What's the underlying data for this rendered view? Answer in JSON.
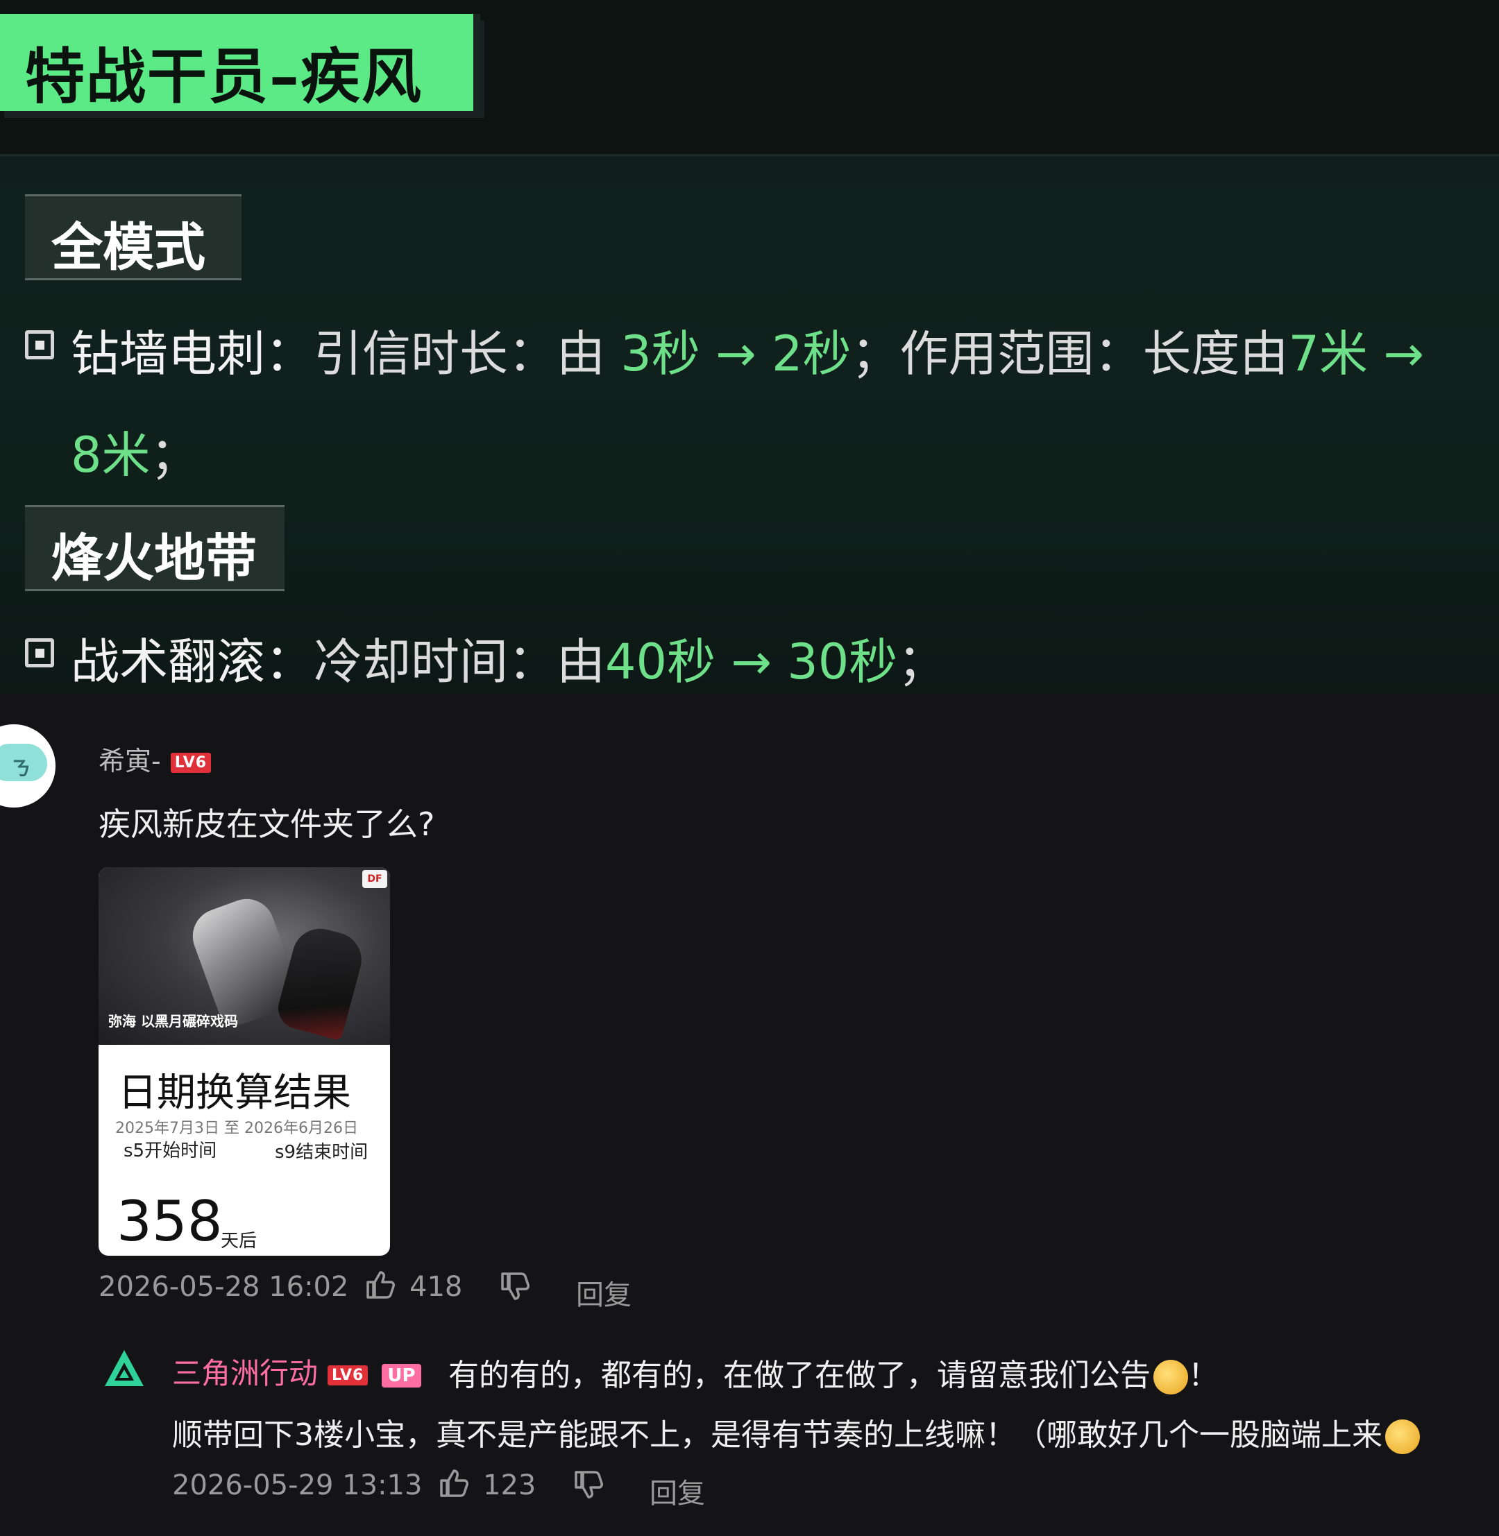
{
  "patch": {
    "title": "特战干员–疾风",
    "sections": [
      {
        "tag": "全模式",
        "items": [
          {
            "name": "钻墙电刺：",
            "line1_a": "引信时长：由 ",
            "line1_b": "3秒",
            "line1_c": " → ",
            "line1_d": "2秒",
            "line1_e": "；作用范围：长度由",
            "line1_f": "7米",
            "line1_g": " →",
            "line2_a": "8米",
            "line2_b": "；"
          }
        ]
      },
      {
        "tag": "烽火地带",
        "items": [
          {
            "name": "战术翻滚：",
            "a": "冷却时间：由",
            "b": "40秒",
            "c": " → ",
            "d": "30秒",
            "e": "；"
          }
        ]
      }
    ]
  },
  "comment": {
    "user": "希寅-",
    "level": "LV6",
    "text": "疾风新皮在文件夹了么?",
    "image_card": {
      "art_caption": "弥海 以黑月碾碎戏码",
      "art_logo": "DF",
      "title": "日期换算结果",
      "dates": "2025年7月3日 至 2026年6月26日",
      "label_start": "s5开始时间",
      "label_end": "s9结束时间",
      "number": "358",
      "unit": "天后"
    },
    "timestamp": "2026-05-28 16:02",
    "likes": "418",
    "reply_label": "回复"
  },
  "reply": {
    "user": "三角洲行动",
    "level": "LV6",
    "up_badge": "UP",
    "text_line1": "有的有的，都有的，在做了在做了，请留意我们公告",
    "text_line1_end": "！",
    "text_line2": "顺带回下3楼小宝，真不是产能跟不上，是得有节奏的上线嘛！（哪敢好几个一股脑端上来",
    "timestamp": "2026-05-29 13:13",
    "likes": "123",
    "reply_label": "回复"
  },
  "colors": {
    "accent_green": "#5bea86",
    "highlight_green": "#6fe08a",
    "up_pink": "#ff6ea0",
    "level_red": "#e0303a"
  },
  "icons": [
    "thumbs-up-icon",
    "thumbs-down-icon",
    "triangle-logo-icon",
    "emoji-icon"
  ]
}
